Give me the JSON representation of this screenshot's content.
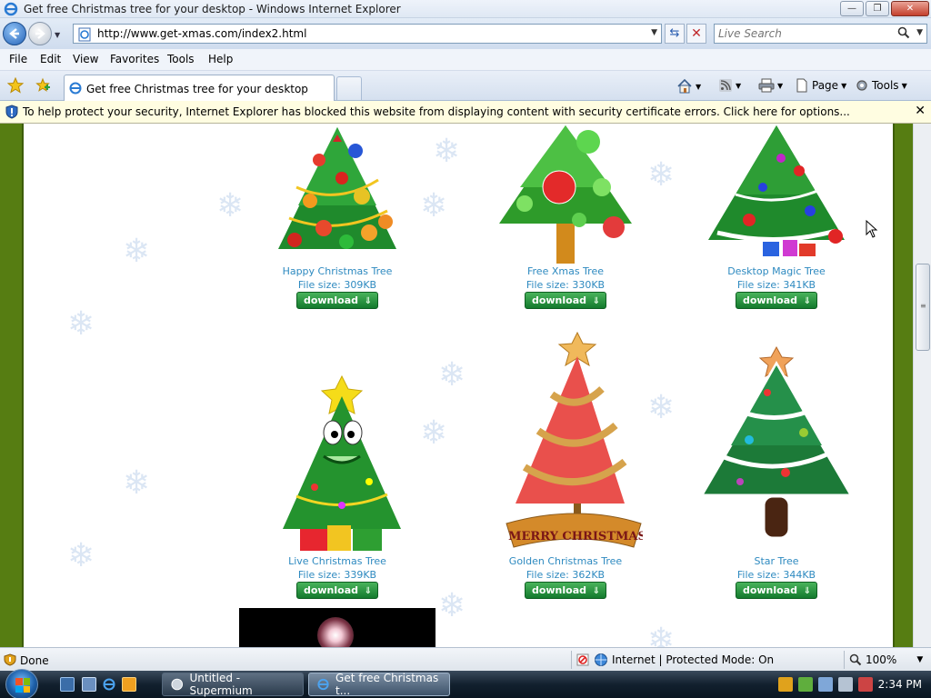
{
  "window": {
    "title": "Get free Christmas tree for your desktop - Windows Internet Explorer",
    "buttons": {
      "minimize": "—",
      "restore": "❐",
      "close": "✕"
    }
  },
  "address": {
    "url": "http://www.get-xmas.com/index2.html",
    "search_placeholder": "Live Search"
  },
  "menu": [
    "File",
    "Edit",
    "View",
    "Favorites",
    "Tools",
    "Help"
  ],
  "tabs": {
    "active_label": "Get free Christmas tree for your desktop"
  },
  "command_bar": {
    "page_label": "Page",
    "tools_label": "Tools"
  },
  "infobar": {
    "text": "To help protect your security, Internet Explorer has blocked this website from displaying content with security certificate errors. Click here for options...",
    "close": "✕"
  },
  "products": [
    {
      "name": "Happy Christmas Tree",
      "size": "File size: 309KB",
      "button": "download"
    },
    {
      "name": "Free Xmas Tree",
      "size": "File size: 330KB",
      "button": "download"
    },
    {
      "name": "Desktop Magic Tree",
      "size": "File size: 341KB",
      "button": "download"
    },
    {
      "name": "Live Christmas Tree",
      "size": "File size: 339KB",
      "button": "download"
    },
    {
      "name": "Golden Christmas Tree",
      "size": "File size: 362KB",
      "button": "download"
    },
    {
      "name": "Star Tree",
      "size": "File size: 344KB",
      "button": "download"
    }
  ],
  "golden_banner": "MERRY CHRISTMAS",
  "status": {
    "text": "Done",
    "zone": "Internet | Protected Mode: On",
    "zoom": "100%"
  },
  "taskbar": {
    "items": [
      {
        "label": "Untitled - Supermium",
        "active": false
      },
      {
        "label": "Get free Christmas t...",
        "active": true
      }
    ],
    "clock": "2:34 PM"
  },
  "colors": {
    "page_border": "#567d12",
    "link": "#2e8ac0",
    "download_button": "#1f8d3a",
    "infobar_bg": "#fffde1"
  }
}
